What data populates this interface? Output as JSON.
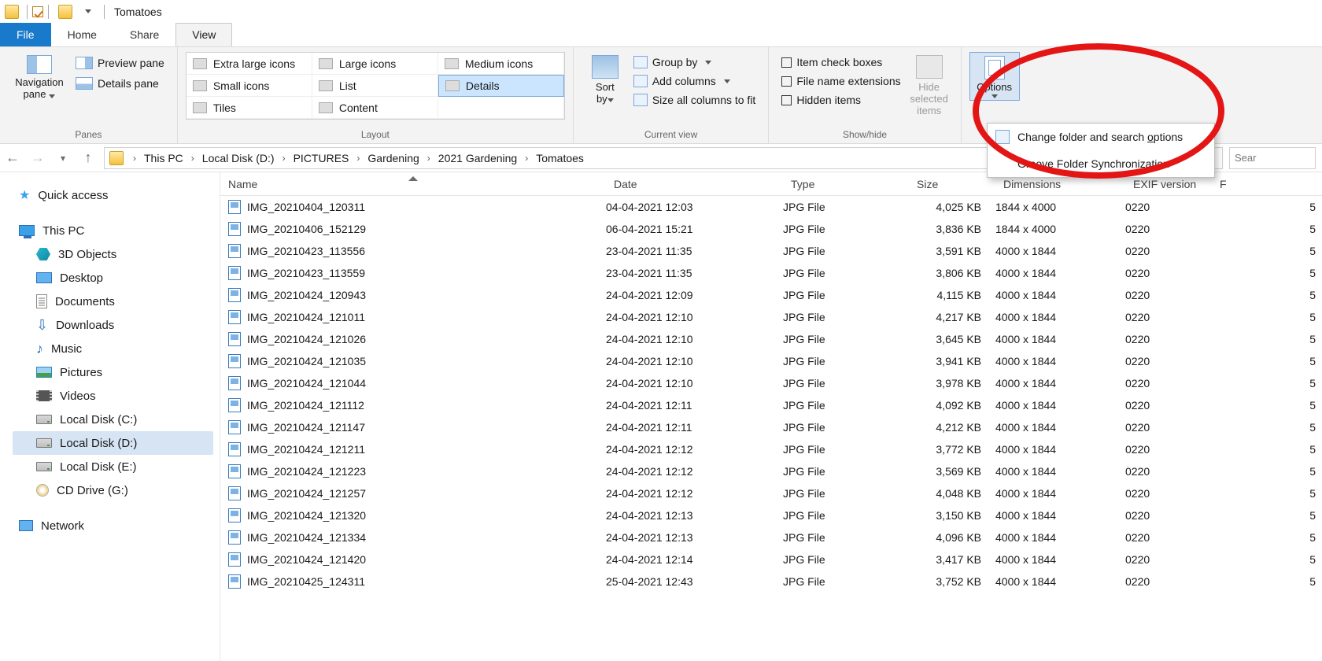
{
  "title": "Tomatoes",
  "tabs": {
    "file": "File",
    "home": "Home",
    "share": "Share",
    "view": "View"
  },
  "ribbon": {
    "panes": {
      "nav": "Navigation pane",
      "preview": "Preview pane",
      "details": "Details pane",
      "group": "Panes"
    },
    "layout": {
      "items": [
        "Extra large icons",
        "Large icons",
        "Medium icons",
        "Small icons",
        "List",
        "Details",
        "Tiles",
        "Content"
      ],
      "selected": "Details",
      "group": "Layout"
    },
    "current": {
      "sort": "Sort by",
      "group_by": "Group by",
      "add_cols": "Add columns",
      "size_all": "Size all columns to fit",
      "group": "Current view"
    },
    "showhide": {
      "checkboxes": "Item check boxes",
      "ext": "File name extensions",
      "hidden": "Hidden items",
      "hide_sel": "Hide selected items",
      "group": "Show/hide"
    },
    "options": {
      "label": "Options",
      "menu": [
        "Change folder and search options",
        "Groove Folder Synchronization"
      ]
    }
  },
  "breadcrumb": [
    "This PC",
    "Local Disk (D:)",
    "PICTURES",
    "Gardening",
    "2021 Gardening",
    "Tomatoes"
  ],
  "search_placeholder": "Sear",
  "sidebar": {
    "quick": "Quick access",
    "thispc": "This PC",
    "children": [
      "3D Objects",
      "Desktop",
      "Documents",
      "Downloads",
      "Music",
      "Pictures",
      "Videos",
      "Local Disk (C:)",
      "Local Disk (D:)",
      "Local Disk (E:)",
      "CD Drive (G:)"
    ],
    "network": "Network",
    "selected": "Local Disk (D:)"
  },
  "columns": [
    "Name",
    "Date",
    "Type",
    "Size",
    "Dimensions",
    "EXIF version",
    "F"
  ],
  "files": [
    {
      "n": "IMG_20210404_120311",
      "d": "04-04-2021 12:03",
      "t": "JPG File",
      "s": "4,025 KB",
      "dim": "1844 x 4000",
      "e": "0220",
      "x": "5"
    },
    {
      "n": "IMG_20210406_152129",
      "d": "06-04-2021 15:21",
      "t": "JPG File",
      "s": "3,836 KB",
      "dim": "1844 x 4000",
      "e": "0220",
      "x": "5"
    },
    {
      "n": "IMG_20210423_113556",
      "d": "23-04-2021 11:35",
      "t": "JPG File",
      "s": "3,591 KB",
      "dim": "4000 x 1844",
      "e": "0220",
      "x": "5"
    },
    {
      "n": "IMG_20210423_113559",
      "d": "23-04-2021 11:35",
      "t": "JPG File",
      "s": "3,806 KB",
      "dim": "4000 x 1844",
      "e": "0220",
      "x": "5"
    },
    {
      "n": "IMG_20210424_120943",
      "d": "24-04-2021 12:09",
      "t": "JPG File",
      "s": "4,115 KB",
      "dim": "4000 x 1844",
      "e": "0220",
      "x": "5"
    },
    {
      "n": "IMG_20210424_121011",
      "d": "24-04-2021 12:10",
      "t": "JPG File",
      "s": "4,217 KB",
      "dim": "4000 x 1844",
      "e": "0220",
      "x": "5"
    },
    {
      "n": "IMG_20210424_121026",
      "d": "24-04-2021 12:10",
      "t": "JPG File",
      "s": "3,645 KB",
      "dim": "4000 x 1844",
      "e": "0220",
      "x": "5"
    },
    {
      "n": "IMG_20210424_121035",
      "d": "24-04-2021 12:10",
      "t": "JPG File",
      "s": "3,941 KB",
      "dim": "4000 x 1844",
      "e": "0220",
      "x": "5"
    },
    {
      "n": "IMG_20210424_121044",
      "d": "24-04-2021 12:10",
      "t": "JPG File",
      "s": "3,978 KB",
      "dim": "4000 x 1844",
      "e": "0220",
      "x": "5"
    },
    {
      "n": "IMG_20210424_121112",
      "d": "24-04-2021 12:11",
      "t": "JPG File",
      "s": "4,092 KB",
      "dim": "4000 x 1844",
      "e": "0220",
      "x": "5"
    },
    {
      "n": "IMG_20210424_121147",
      "d": "24-04-2021 12:11",
      "t": "JPG File",
      "s": "4,212 KB",
      "dim": "4000 x 1844",
      "e": "0220",
      "x": "5"
    },
    {
      "n": "IMG_20210424_121211",
      "d": "24-04-2021 12:12",
      "t": "JPG File",
      "s": "3,772 KB",
      "dim": "4000 x 1844",
      "e": "0220",
      "x": "5"
    },
    {
      "n": "IMG_20210424_121223",
      "d": "24-04-2021 12:12",
      "t": "JPG File",
      "s": "3,569 KB",
      "dim": "4000 x 1844",
      "e": "0220",
      "x": "5"
    },
    {
      "n": "IMG_20210424_121257",
      "d": "24-04-2021 12:12",
      "t": "JPG File",
      "s": "4,048 KB",
      "dim": "4000 x 1844",
      "e": "0220",
      "x": "5"
    },
    {
      "n": "IMG_20210424_121320",
      "d": "24-04-2021 12:13",
      "t": "JPG File",
      "s": "3,150 KB",
      "dim": "4000 x 1844",
      "e": "0220",
      "x": "5"
    },
    {
      "n": "IMG_20210424_121334",
      "d": "24-04-2021 12:13",
      "t": "JPG File",
      "s": "4,096 KB",
      "dim": "4000 x 1844",
      "e": "0220",
      "x": "5"
    },
    {
      "n": "IMG_20210424_121420",
      "d": "24-04-2021 12:14",
      "t": "JPG File",
      "s": "3,417 KB",
      "dim": "4000 x 1844",
      "e": "0220",
      "x": "5"
    },
    {
      "n": "IMG_20210425_124311",
      "d": "25-04-2021 12:43",
      "t": "JPG File",
      "s": "3,752 KB",
      "dim": "4000 x 1844",
      "e": "0220",
      "x": "5"
    }
  ]
}
